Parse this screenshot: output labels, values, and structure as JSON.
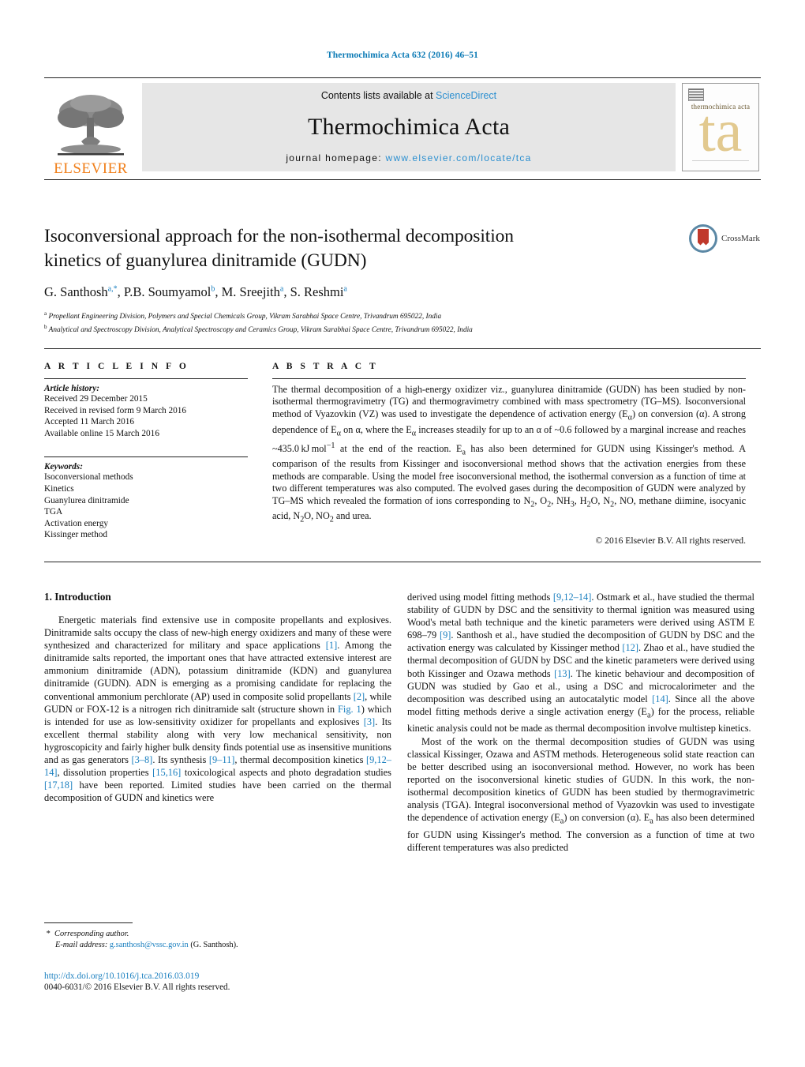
{
  "running_head": "Thermochimica Acta 632 (2016) 46–51",
  "masthead": {
    "publisher_logo_text": "ELSEVIER",
    "contents_prefix": "Contents lists available at ",
    "contents_link": "ScienceDirect",
    "journal_title": "Thermochimica Acta",
    "homepage_prefix": "journal homepage: ",
    "homepage_url": "www.elsevier.com/locate/tca",
    "cover_title": "thermochimica acta",
    "cover_monogram": "ta"
  },
  "article": {
    "title": "Isoconversional approach for the non-isothermal decomposition kinetics of guanylurea dinitramide (GUDN)",
    "title_line1": "Isoconversional approach for the non-isothermal decomposition",
    "title_line2": "kinetics of guanylurea dinitramide (GUDN)",
    "authors_plain": "G. Santhosh a,*, P.B. Soumyamol b, M. Sreejith a, S. Reshmi a",
    "affiliation_a": "Propellant Engineering Division, Polymers and Special Chemicals Group, Vikram Sarabhai Space Centre, Trivandrum 695022, India",
    "affiliation_b": "Analytical and Spectroscopy Division, Analytical Spectroscopy and Ceramics Group, Vikram Sarabhai Space Centre, Trivandrum 695022, India",
    "crossmark_label": "CrossMark"
  },
  "article_info": {
    "heading": "A R T I C L E  I N F O",
    "history_label": "Article history:",
    "history": [
      "Received 29 December 2015",
      "Received in revised form 9 March 2016",
      "Accepted 11 March 2016",
      "Available online 15 March 2016"
    ],
    "keywords_label": "Keywords:",
    "keywords": [
      "Isoconversional methods",
      "Kinetics",
      "Guanylurea dinitramide",
      "TGA",
      "Activation energy",
      "Kissinger method"
    ]
  },
  "abstract": {
    "heading": "A B S T R A C T",
    "copyright": "© 2016 Elsevier B.V. All rights reserved."
  },
  "introduction": {
    "heading": "1.  Introduction"
  },
  "footnote": {
    "corresponding_marker": "*",
    "corresponding_label": "Corresponding author.",
    "email_label": "E-mail address:",
    "email": "g.santhosh@vssc.gov.in",
    "email_attrib": "(G. Santhosh)."
  },
  "footer": {
    "doi": "http://dx.doi.org/10.1016/j.tca.2016.03.019",
    "issn_line": "0040-6031/© 2016 Elsevier B.V. All rights reserved."
  },
  "colors": {
    "link": "#1a7fbf",
    "header_blue": "#0b7ab5",
    "elsevier_orange": "#f07f1a",
    "banner_gray": "#e6e6e6"
  }
}
